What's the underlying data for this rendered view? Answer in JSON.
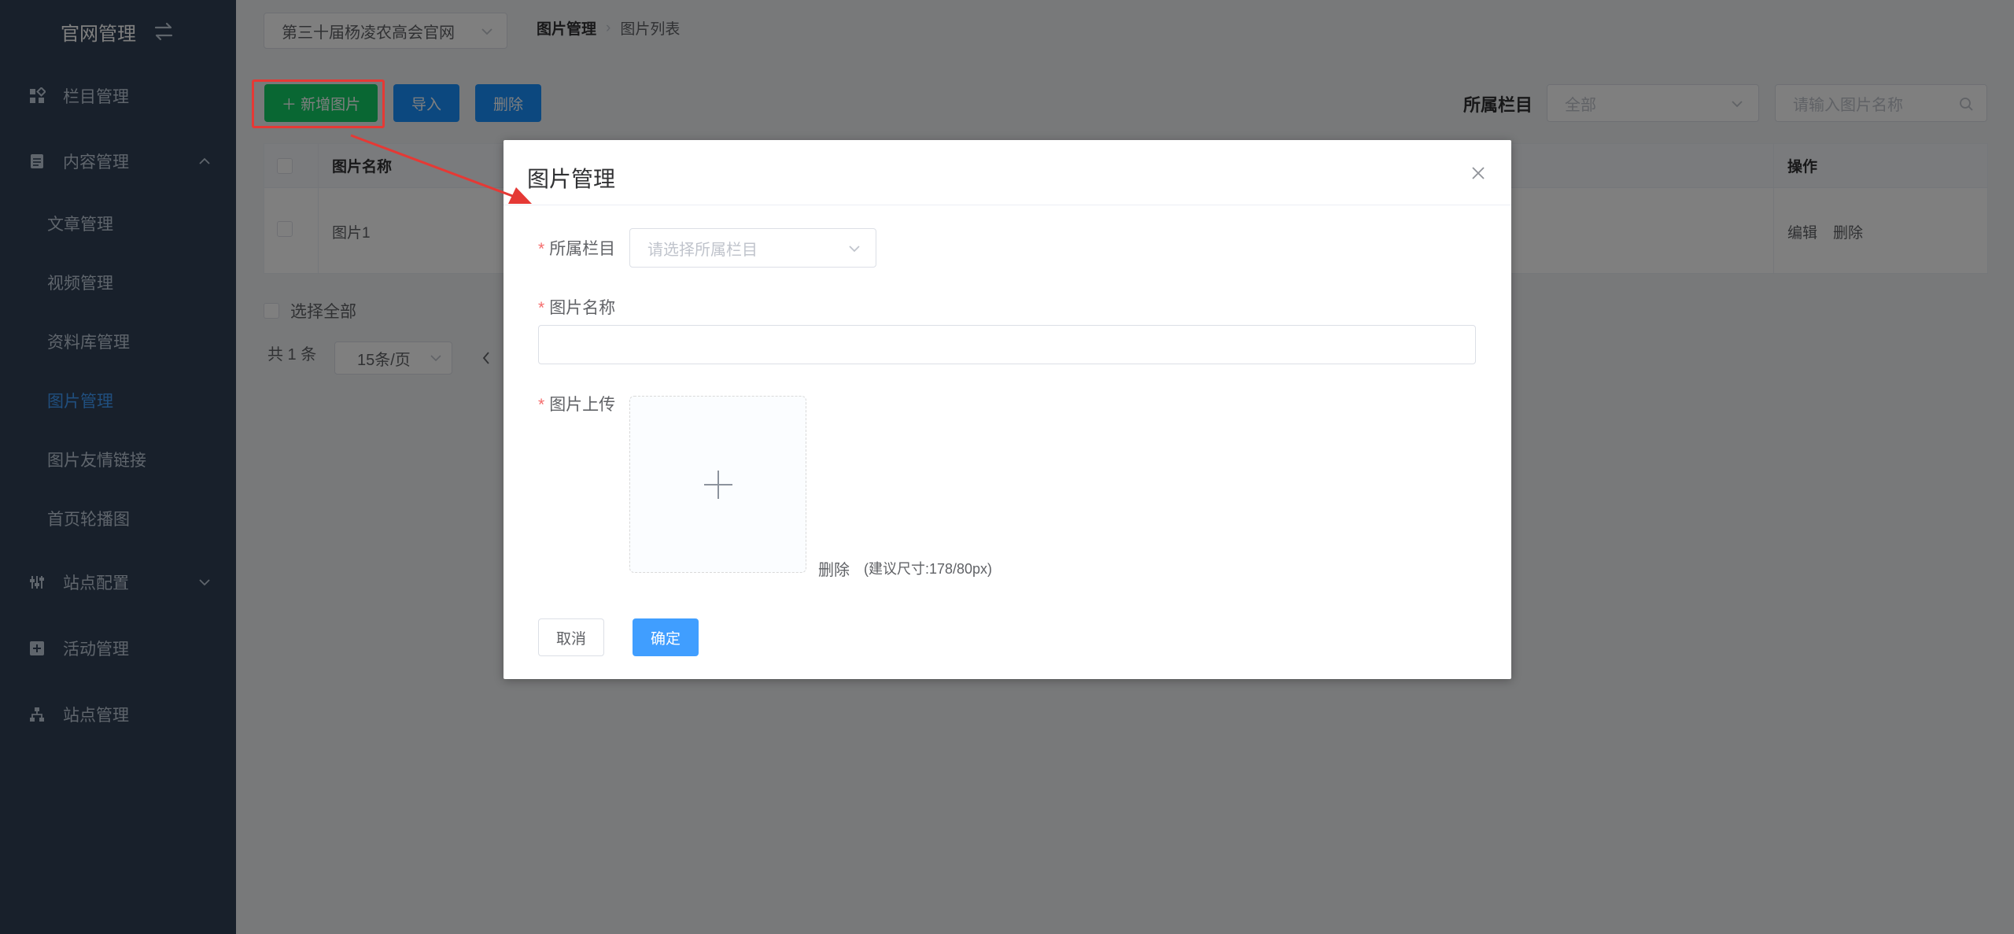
{
  "sidebar": {
    "brand": "官网管理",
    "items": [
      {
        "label": "栏目管理",
        "icon": "grid-icon"
      },
      {
        "label": "内容管理",
        "icon": "document-icon",
        "expanded": true
      },
      {
        "label": "站点配置",
        "icon": "sliders-icon",
        "expanded": false
      },
      {
        "label": "活动管理",
        "icon": "plus-square-icon"
      },
      {
        "label": "站点管理",
        "icon": "sitemap-icon"
      }
    ],
    "sub_items": [
      "文章管理",
      "视频管理",
      "资料库管理",
      "图片管理",
      "图片友情链接",
      "首页轮播图"
    ],
    "active_sub": "图片管理"
  },
  "header": {
    "site_select": "第三十届杨凌农高会官网",
    "breadcrumb": [
      "图片管理",
      "图片列表"
    ]
  },
  "toolbar": {
    "add_label": "＋ 新增图片",
    "import_label": "导入",
    "delete_label": "删除",
    "filter_label": "所属栏目",
    "filter_value": "全部",
    "search_placeholder": "请输入图片名称"
  },
  "table": {
    "columns": {
      "name": "图片名称",
      "actions": "操作"
    },
    "rows": [
      {
        "name": "图片1",
        "edit": "编辑",
        "delete": "删除"
      }
    ],
    "select_all": "选择全部"
  },
  "pager": {
    "total": "共 1 条",
    "page_size": "15条/页"
  },
  "dialog": {
    "title": "图片管理",
    "required_mark": "*",
    "category_label": "所属栏目",
    "category_placeholder": "请选择所属栏目",
    "name_label": "图片名称",
    "upload_label": "图片上传",
    "upload_delete": "删除",
    "upload_hint": "(建议尺寸:178/80px)",
    "cancel_label": "取消",
    "confirm_label": "确定"
  },
  "colors": {
    "sidebar_bg": "#304156",
    "accent": "#409eff",
    "success": "#13ce66",
    "annotation": "#e53935"
  }
}
